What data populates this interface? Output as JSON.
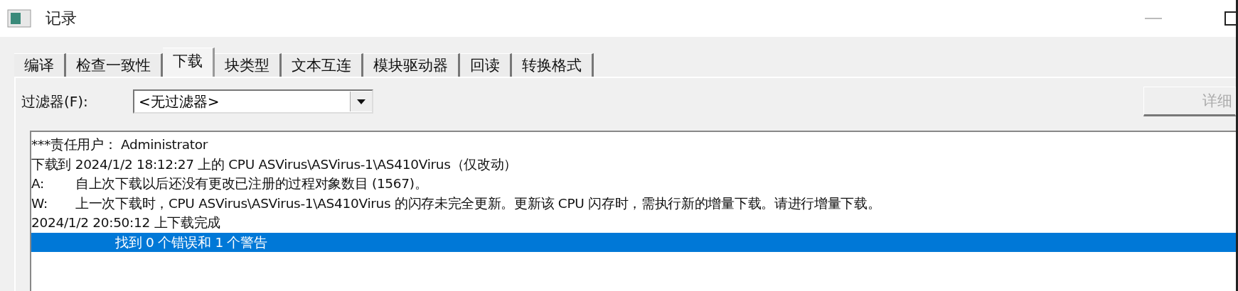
{
  "window": {
    "title": "记录"
  },
  "tabs": [
    {
      "label": "编译",
      "selected": false
    },
    {
      "label": "检查一致性",
      "selected": false
    },
    {
      "label": "下载",
      "selected": true
    },
    {
      "label": "块类型",
      "selected": false
    },
    {
      "label": "文本互连",
      "selected": false
    },
    {
      "label": "模块驱动器",
      "selected": false
    },
    {
      "label": "回读",
      "selected": false
    },
    {
      "label": "转换格式",
      "selected": false
    }
  ],
  "filter": {
    "label": "过滤器(F):",
    "value": "<无过滤器>"
  },
  "details_button": {
    "label": "详细",
    "disabled": true
  },
  "log": [
    {
      "kind": "plain",
      "text": "***责任用户：  Administrator",
      "selected": false
    },
    {
      "kind": "plain",
      "text": "下载到 2024/1/2 18:12:27 上的 CPU ASVirus\\ASVirus-1\\AS410Virus（仅改动）",
      "selected": false
    },
    {
      "kind": "prefixed",
      "prefix": "A:",
      "text": "自上次下载以后还没有更改已注册的过程对象数目 (1567)。",
      "selected": false
    },
    {
      "kind": "prefixed",
      "prefix": "W:",
      "text": "上一次下载时，CPU ASVirus\\ASVirus-1\\AS410Virus 的闪存未完全更新。更新该 CPU 闪存时，需执行新的增量下载。请进行增量下载。",
      "selected": false
    },
    {
      "kind": "plain",
      "text": "2024/1/2 20:50:12 上下载完成",
      "selected": false
    },
    {
      "kind": "summary",
      "text": "找到 0 个错误和 1 个警告",
      "selected": true
    }
  ]
}
